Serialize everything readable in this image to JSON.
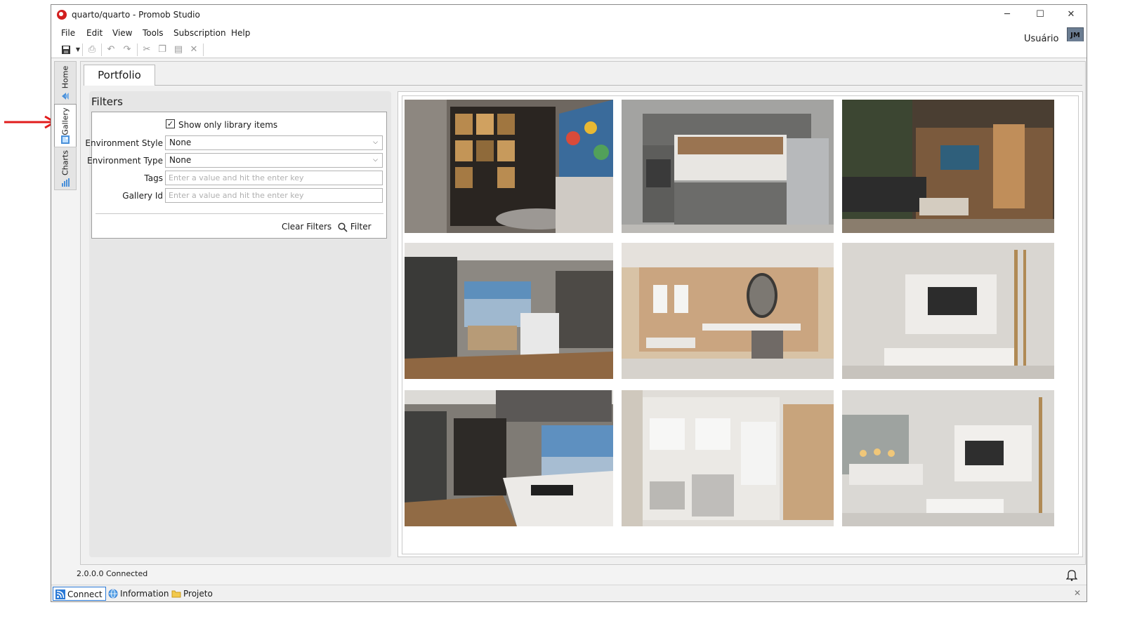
{
  "window": {
    "title": "quarto/quarto - Promob Studio",
    "minimize": "─",
    "maximize": "☐",
    "close": "✕"
  },
  "menu": {
    "file": "File",
    "edit": "Edit",
    "view": "View",
    "tools": "Tools",
    "subscription": "Subscription",
    "help": "Help"
  },
  "user": {
    "name": "Usuário",
    "initials": "JM"
  },
  "sidebar": {
    "tabs": [
      "Home",
      "Gallery",
      "Charts"
    ],
    "active": "Gallery"
  },
  "main_tab": "Portfolio",
  "filters": {
    "title": "Filters",
    "show_only_library": {
      "label": "Show only library items",
      "checked": true
    },
    "environment_style": {
      "label": "Environment Style",
      "value": "None"
    },
    "environment_type": {
      "label": "Environment Type",
      "value": "None"
    },
    "tags": {
      "label": "Tags",
      "placeholder": "Enter a value and hit the enter key"
    },
    "gallery_id": {
      "label": "Gallery Id",
      "placeholder": "Enter a value and hit the enter key"
    },
    "clear_label": "Clear Filters",
    "filter_label": "Filter"
  },
  "gallery": {
    "items": [
      "living-room-shelves-painting",
      "gray-kitchen",
      "tv-room-wood-shelves",
      "open-kitchen-dining-window",
      "dressing-vanity-mirror",
      "white-tv-panel-living",
      "kitchen-island-hood",
      "walk-in-wardrobe",
      "dining-living-white"
    ]
  },
  "status": {
    "text": "2.0.0.0  Connected"
  },
  "bottom": {
    "connect": "Connect",
    "information": "Information",
    "project": "Projeto"
  },
  "colors": {
    "accent": "#2a79d6",
    "annotation_arrow": "#e11c1c"
  }
}
